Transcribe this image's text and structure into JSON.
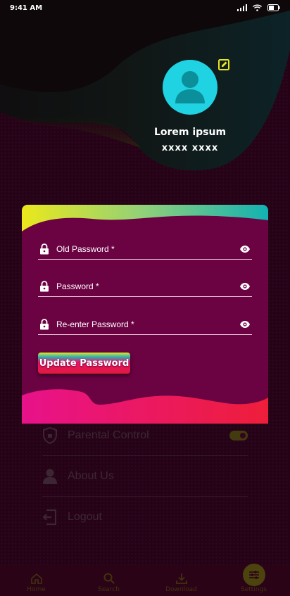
{
  "status_bar": {
    "time": "9:41 AM"
  },
  "profile": {
    "name": "Lorem ipsum",
    "id": "xxxx xxxx"
  },
  "modal": {
    "fields": [
      {
        "placeholder": "Old Password *"
      },
      {
        "placeholder": "Password *"
      },
      {
        "placeholder": "Re-enter Password *"
      }
    ],
    "button_label": "Update Password"
  },
  "settings": {
    "items": [
      {
        "label": "Parental Control",
        "icon": "shield-icon"
      },
      {
        "label": "About Us",
        "icon": "user-icon"
      },
      {
        "label": "Logout",
        "icon": "logout-icon"
      }
    ]
  },
  "nav": {
    "items": [
      {
        "label": "Home",
        "icon": "home-icon"
      },
      {
        "label": "Search",
        "icon": "search-icon"
      },
      {
        "label": "Download",
        "icon": "download-icon"
      },
      {
        "label": "Settings",
        "icon": "settings-icon",
        "active": true
      }
    ]
  },
  "colors": {
    "accent_cyan": "#1fd3e3",
    "modal_bg": "#6b0343",
    "gradient_pink": "#e7126d",
    "gradient_yellow": "#e8e620"
  }
}
